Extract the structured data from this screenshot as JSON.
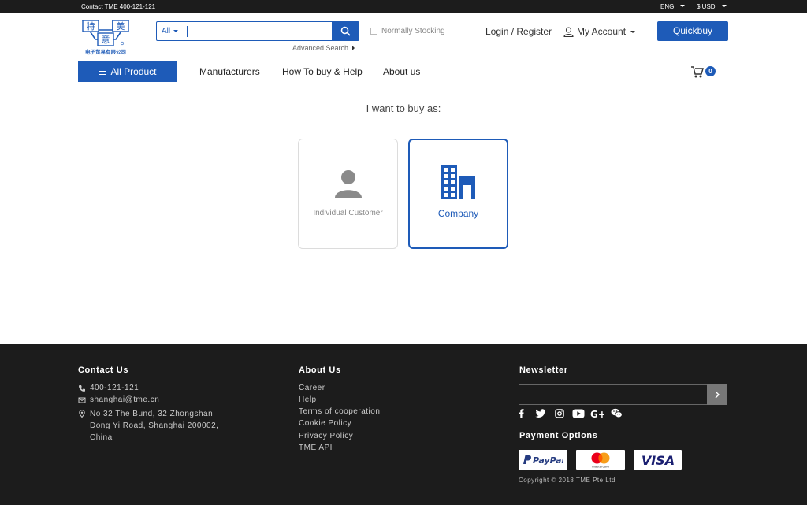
{
  "topbar": {
    "contact": "Contact TME 400-121-121",
    "language": "ENG",
    "currency": "$ USD"
  },
  "logo": {
    "char1": "特",
    "char2": "美",
    "char3": "意",
    "subtitle": "电子贸易有限公司"
  },
  "search": {
    "category": "All",
    "placeholder": "",
    "value": "",
    "advanced": "Advanced Search"
  },
  "header": {
    "stocking": "Normally Stocking",
    "login": "Login / Register",
    "account": "My Account",
    "quickbuy": "Quickbuy"
  },
  "nav": {
    "all_product": "All Product",
    "links": [
      "Manufacturers",
      "How To buy & Help",
      "About us"
    ],
    "cart_count": "0"
  },
  "main": {
    "prompt": "I want to buy as:",
    "individual": "Individual Customer",
    "company": "Company"
  },
  "footer": {
    "contact_title": "Contact Us",
    "phone": "400-121-121",
    "email": "shanghai@tme.cn",
    "address": [
      "No 32 The Bund, 32 Zhongshan",
      "Dong Yi Road, Shanghai 200002,",
      "China"
    ],
    "about_title": "About Us",
    "about_links": [
      "Career",
      "Help",
      "Terms of cooperation",
      "Cookie Policy",
      "Privacy Policy",
      "TME API"
    ],
    "newsletter_title": "Newsletter",
    "newsletter_value": "",
    "payment_title": "Payment Options",
    "payments": [
      "PayPal",
      "mastercard",
      "VISA"
    ],
    "copyright": "Copyright © 2018 TME Pte Ltd"
  },
  "colors": {
    "primary": "#1e5bb8",
    "dark": "#1c1c1c"
  },
  "icons": [
    "caret-down-icon",
    "search-icon",
    "user-icon",
    "cart-icon",
    "phone-icon",
    "mail-icon",
    "location-icon",
    "facebook-icon",
    "twitter-icon",
    "instagram-icon",
    "youtube-icon",
    "google-plus-icon",
    "wechat-icon",
    "arrow-right-icon",
    "building-icon"
  ]
}
